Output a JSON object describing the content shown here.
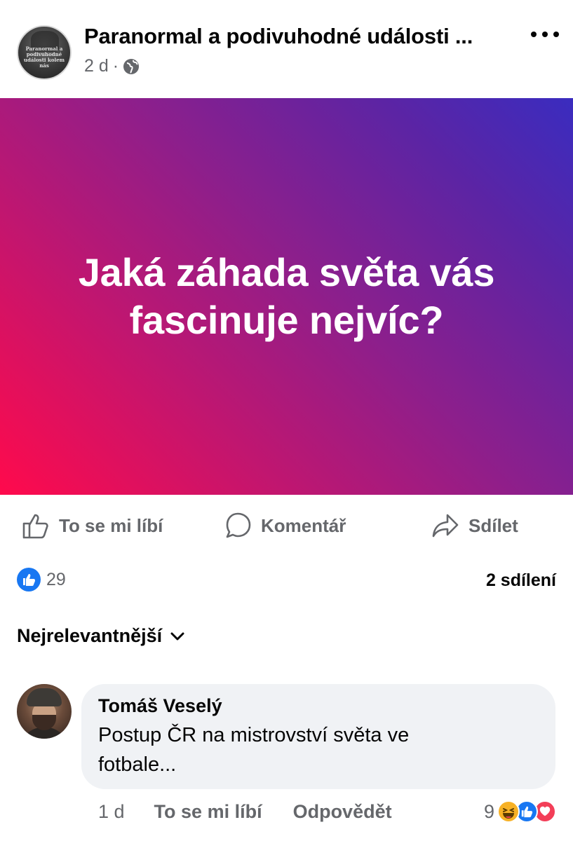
{
  "post": {
    "page_name": "Paranormal a podivuhodné události ...",
    "avatar_text": "Paranormal a podivuhodné události kolem nás",
    "time": "2 d",
    "separator": "·",
    "audience_icon": "globe-icon",
    "more_icon": "more-options-icon",
    "image_text": "Jaká záhada světa vás fascinuje nejvíc?",
    "image_gradient": [
      "#ff0a4c",
      "#3a2cbf"
    ]
  },
  "actions": {
    "like_label": "To se mi líbí",
    "comment_label": "Komentář",
    "share_label": "Sdílet"
  },
  "stats": {
    "like_count": "29",
    "shares": "2 sdílení"
  },
  "comments": {
    "sort_label": "Nejrelevantnější",
    "items": [
      {
        "author": "Tomáš Veselý",
        "text": "Postup ČR na mistrovství světa ve fotbale...",
        "time": "1 d",
        "like_label": "To se mi líbí",
        "reply_label": "Odpovědět",
        "reaction_count": "9",
        "reaction_icons": [
          "haha-icon",
          "like-icon",
          "love-icon"
        ]
      }
    ]
  },
  "colors": {
    "accent": "#1877f2",
    "secondary_text": "#65676b",
    "bubble": "#f0f2f5"
  }
}
